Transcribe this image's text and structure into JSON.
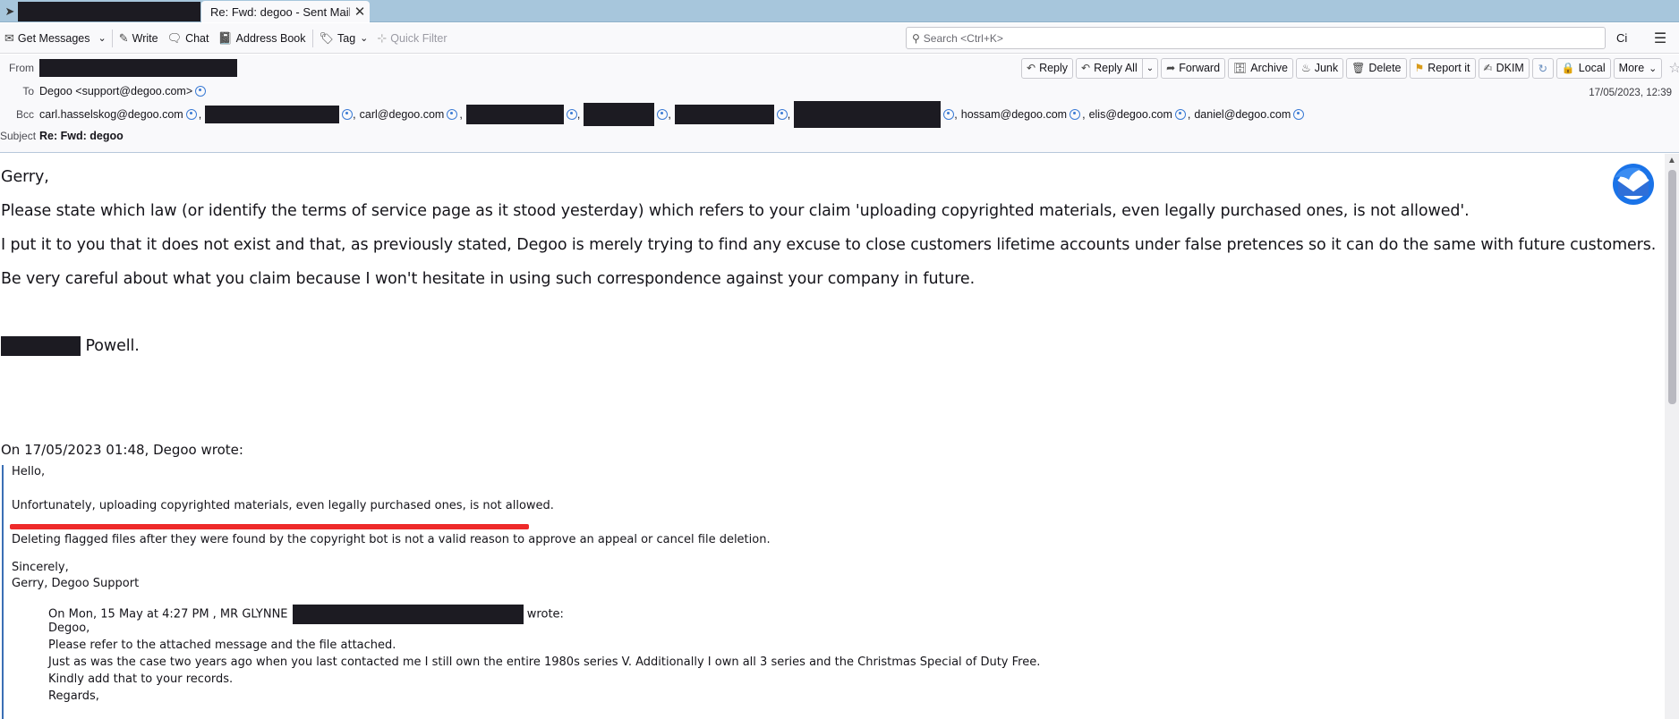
{
  "tabs": {
    "active_title": "Re: Fwd: degoo - Sent Mail -"
  },
  "toolbar": {
    "get_messages": "Get Messages",
    "write": "Write",
    "chat": "Chat",
    "address_book": "Address Book",
    "tag": "Tag",
    "quick_filter": "Quick Filter",
    "search_placeholder": "Search <Ctrl+K>",
    "ci": "Ci"
  },
  "header": {
    "from_label": "From",
    "to_label": "To",
    "bcc_label": "Bcc",
    "subject_label": "Subject",
    "to_value": "Degoo <support@degoo.com>",
    "bcc": [
      "carl.hasselskog@degoo.com",
      "carl@degoo.com",
      "hossam@degoo.com",
      "elis@degoo.com",
      "daniel@degoo.com"
    ],
    "subject": "Re: Fwd: degoo",
    "date": "17/05/2023, 12:39",
    "actions": {
      "reply": "Reply",
      "reply_all": "Reply All",
      "forward": "Forward",
      "archive": "Archive",
      "junk": "Junk",
      "delete": "Delete",
      "report": "Report it",
      "dkim": "DKIM",
      "local": "Local",
      "more": "More"
    }
  },
  "message": {
    "greeting": "Gerry,",
    "para1": "Please state which law (or identify the terms of service page as it stood yesterday) which refers to your claim 'uploading copyrighted materials, even legally purchased ones, is not allowed'.",
    "para2": "I put it to you that it does not exist and that, as previously stated, Degoo is merely trying to find any excuse to close customers lifetime accounts under false pretences so it can do the same with future customers.",
    "para3": "Be very careful about what you claim because I won't hesitate in using such correspondence against your company in future.",
    "signoff": "Powell.",
    "quote_header": "On 17/05/2023 01:48, Degoo wrote:",
    "quote": {
      "hello": "Hello,",
      "line1": "Unfortunately, uploading copyrighted materials, even legally purchased ones, is not allowed.",
      "line2": "Deleting flagged files after they were found by the copyright bot is not a valid reason to approve an appeal or cancel file deletion.",
      "sincerely": "Sincerely,",
      "sig": "Gerry, Degoo Support",
      "inner_header_pre": "On Mon, 15 May at 4:27 PM , MR GLYNNE",
      "inner_header_post": "wrote:",
      "inner_lines": [
        "Degoo,",
        "Please refer to the attached message and the file attached.",
        "Just as was the case two years ago when you last contacted me I still own the entire 1980s series V.  Additionally I own all 3 series and the Christmas Special of Duty Free.",
        "Kindly add that to your records.",
        "Regards,"
      ]
    }
  }
}
